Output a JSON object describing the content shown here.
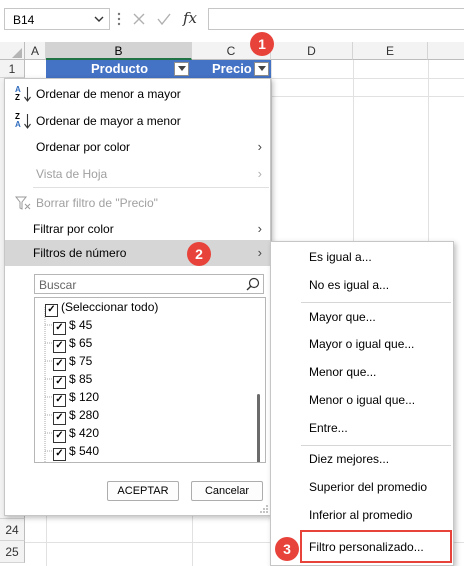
{
  "formula_bar": {
    "name_box_value": "B14",
    "formula_value": "",
    "fx_label": "fx"
  },
  "columns": [
    "A",
    "B",
    "C",
    "D",
    "E"
  ],
  "rows": [
    "1",
    "24",
    "25"
  ],
  "table": {
    "header_b": "Producto",
    "header_c": "Precio"
  },
  "menu": {
    "items": [
      {
        "label": "Ordenar de menor a mayor",
        "icon": "sort-ascending-icon"
      },
      {
        "label": "Ordenar de mayor a menor",
        "icon": "sort-descending-icon"
      },
      {
        "label": "Ordenar por color"
      },
      {
        "label": "Vista de Hoja"
      },
      {
        "label": "Borrar filtro de \"Precio\"",
        "icon": "clear-filter-icon"
      },
      {
        "label": "Filtrar por color"
      },
      {
        "label": "Filtros de número"
      }
    ],
    "sort_glyphs": {
      "a": "A",
      "z": "Z"
    },
    "search_placeholder": "Buscar",
    "list": [
      "(Seleccionar todo)",
      "$ 45",
      "$ 65",
      "$ 75",
      "$ 85",
      "$ 120",
      "$ 280",
      "$ 420",
      "$ 540"
    ],
    "ok_label": "ACEPTAR",
    "cancel_label": "Cancelar"
  },
  "submenu": {
    "items": [
      "Es igual a...",
      "No es igual a...",
      "Mayor que...",
      "Mayor o igual que...",
      "Menor que...",
      "Menor o igual que...",
      "Entre...",
      "Diez mejores...",
      "Superior del promedio",
      "Inferior al promedio",
      "Filtro personalizado..."
    ]
  },
  "badges": [
    "1",
    "2",
    "3"
  ],
  "colors": {
    "table_header": "#4472c4",
    "badge": "#e8433a",
    "highlight": "#d6d6d6",
    "excel_green": "#217346"
  }
}
